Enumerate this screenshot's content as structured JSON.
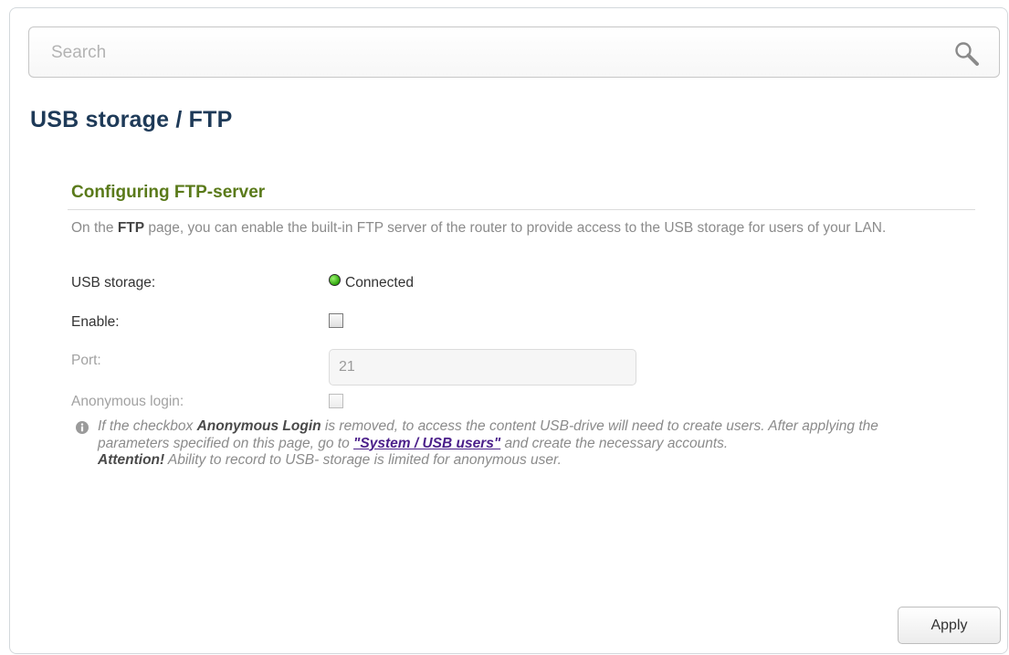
{
  "search": {
    "placeholder": "Search"
  },
  "page": {
    "title": "USB storage /  FTP"
  },
  "section": {
    "title": "Configuring FTP-server",
    "desc_pre": "On the ",
    "desc_bold": "FTP",
    "desc_post": " page, you can enable the built-in FTP server of the router to provide access to the USB storage for users of your LAN."
  },
  "form": {
    "usb_storage_label": "USB storage:",
    "usb_storage_status": "Connected",
    "enable_label": "Enable:",
    "port_label": "Port:",
    "port_value": "21",
    "anonymous_label": "Anonymous login:"
  },
  "note": {
    "part1": "If the checkbox ",
    "bold1": "Anonymous Login",
    "part2": " is removed, to access the content USB-drive will need to create users. After applying the parameters specified on this page, go to ",
    "link": "\"System / USB users\"",
    "part3": " and create the necessary accounts.",
    "attention": "Attention!",
    "part4": " Ability to record to USB- storage is limited for anonymous user."
  },
  "apply_label": "Apply",
  "colors": {
    "title": "#1e3a58",
    "section": "#5a7a1a",
    "link": "#4b1f8a",
    "status_ok": "#2ea40c"
  },
  "icons": [
    "search-icon",
    "info-icon",
    "status-connected-icon"
  ]
}
